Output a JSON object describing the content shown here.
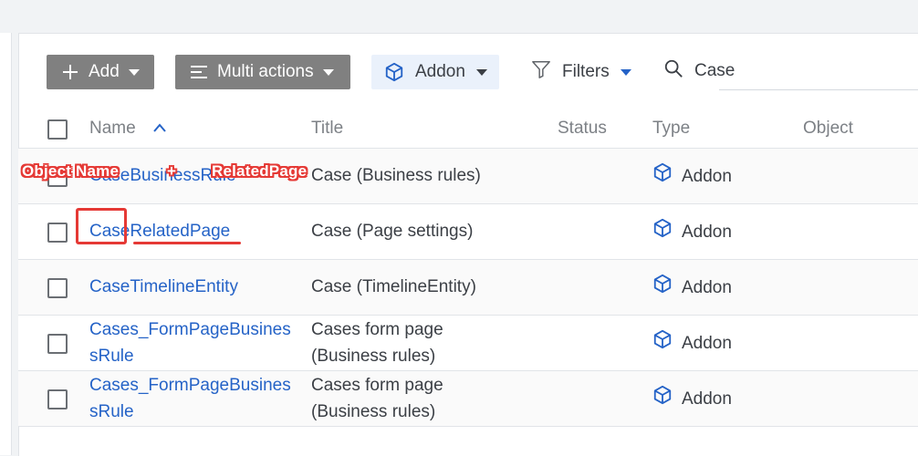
{
  "toolbar": {
    "add_label": "Add",
    "multi_actions_label": "Multi actions",
    "addon_label": "Addon",
    "filters_label": "Filters",
    "search_value": "Case"
  },
  "table": {
    "columns": [
      "Name",
      "Title",
      "Status",
      "Type",
      "Object"
    ],
    "rows": [
      {
        "name": "CaseBusinessRule",
        "title": "Case (Business rules)",
        "status": "",
        "type": "Addon",
        "object": ""
      },
      {
        "name_part1": "Case",
        "name_part2": "RelatedPage",
        "title": "Case (Page settings)",
        "status": "",
        "type": "Addon",
        "object": ""
      },
      {
        "name": "CaseTimelineEntity",
        "title": "Case (TimelineEntity)",
        "status": "",
        "type": "Addon",
        "object": ""
      },
      {
        "name_line1": "Cases_FormPageBusines",
        "name_line2": "sRule",
        "title_line1": "Cases form page",
        "title_line2": "(Business rules)",
        "status": "",
        "type": "Addon",
        "object": ""
      },
      {
        "name_line1": "Cases_FormPageBusines",
        "name_line2": "sRule",
        "title_line1": "Cases form page",
        "title_line2": "(Business rules)",
        "status": "",
        "type": "Addon",
        "object": ""
      }
    ]
  },
  "annotation": {
    "object_name": "Object Name",
    "plus": "+",
    "related_page": "RelatedPage"
  },
  "colors": {
    "link": "#2563c7",
    "annotation_red": "#e53935",
    "button_grey": "#808080",
    "addon_bg": "#eaf1fb"
  }
}
